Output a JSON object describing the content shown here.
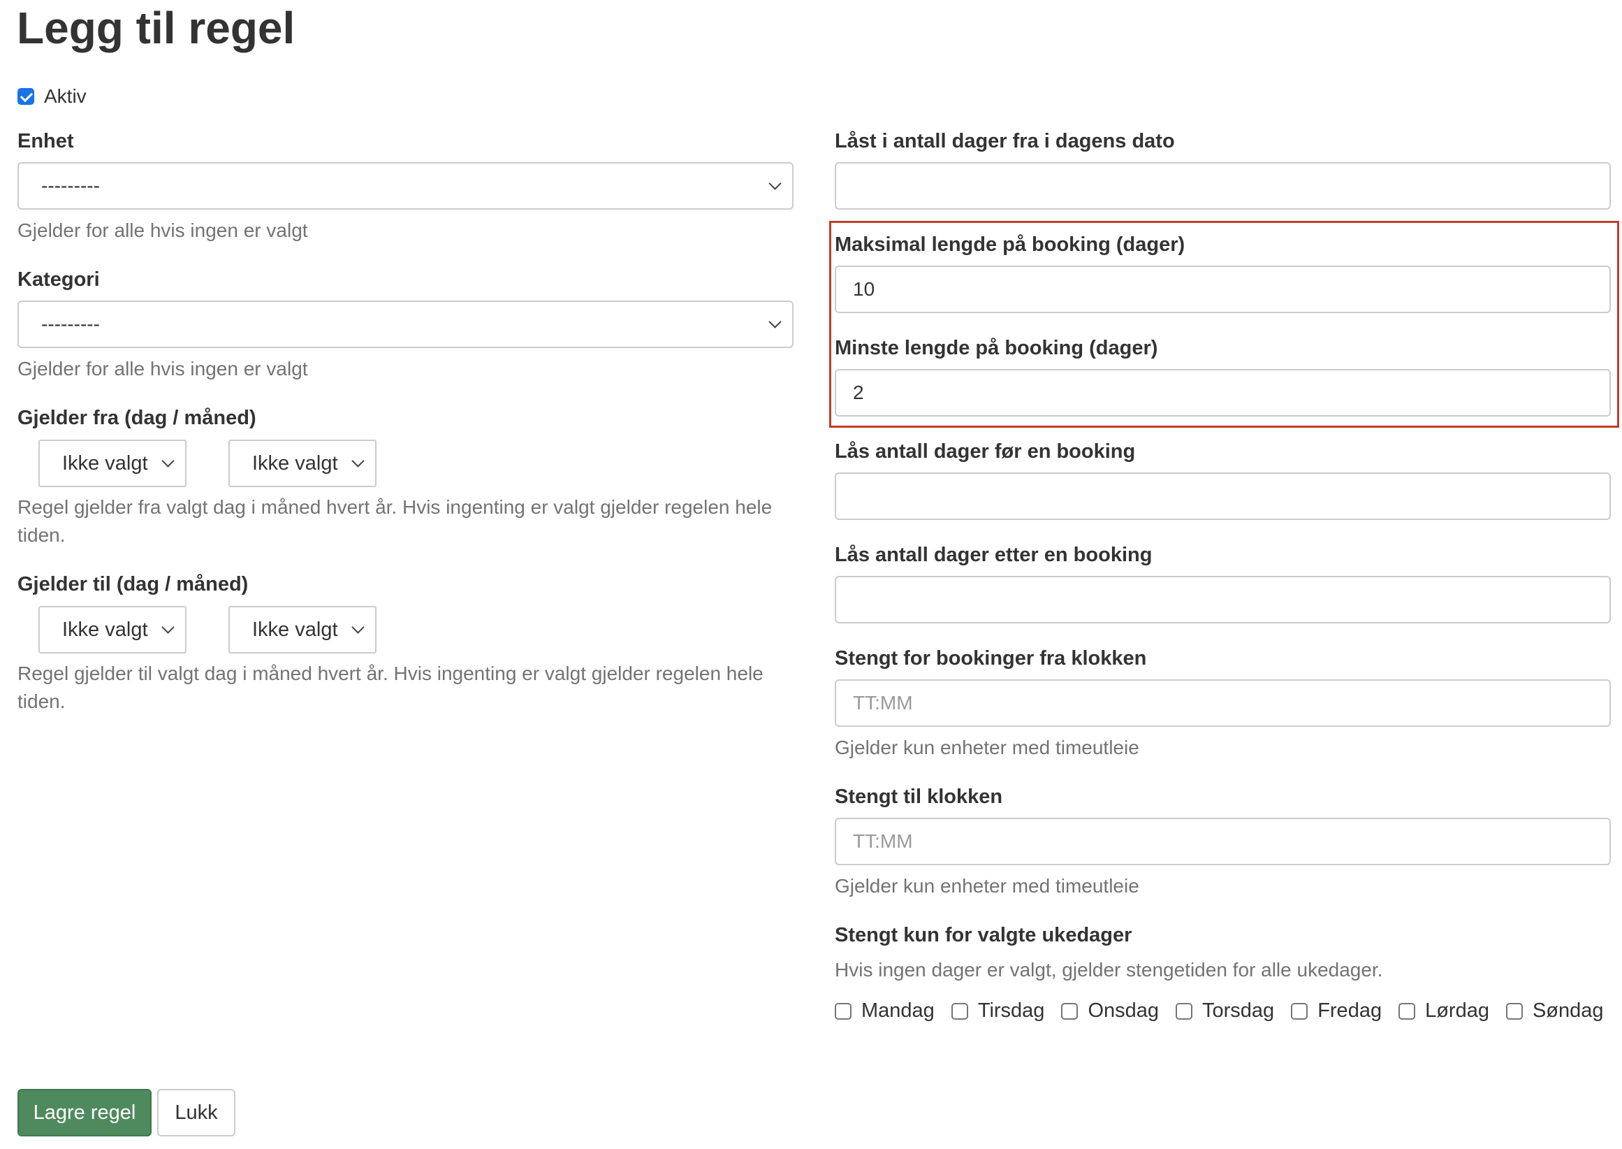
{
  "page": {
    "title": "Legg til regel"
  },
  "aktiv": {
    "label": "Aktiv",
    "checked": true
  },
  "left": {
    "enhet": {
      "label": "Enhet",
      "value": "---------",
      "help": "Gjelder for alle hvis ingen er valgt"
    },
    "kategori": {
      "label": "Kategori",
      "value": "---------",
      "help": "Gjelder for alle hvis ingen er valgt"
    },
    "fra": {
      "label": "Gjelder fra (dag / måned)",
      "day_value": "Ikke valgt",
      "month_value": "Ikke valgt",
      "help_line1": "Regel gjelder fra valgt dag i måned hvert år. Hvis ingenting er valgt gjelder regelen hele",
      "help_line2": "tiden."
    },
    "til": {
      "label": "Gjelder til (dag / måned)",
      "day_value": "Ikke valgt",
      "month_value": "Ikke valgt",
      "help_line1": "Regel gjelder til valgt dag i måned hvert år. Hvis ingenting er valgt gjelder regelen hele",
      "help_line2": "tiden."
    }
  },
  "right": {
    "laast": {
      "label": "Låst i antall dager fra i dagens dato",
      "value": ""
    },
    "maks": {
      "label": "Maksimal lengde på booking (dager)",
      "value": "10"
    },
    "minste": {
      "label": "Minste lengde på booking (dager)",
      "value": "2"
    },
    "laas_for": {
      "label": "Lås antall dager før en booking",
      "value": ""
    },
    "laas_etter": {
      "label": "Lås antall dager etter en booking",
      "value": ""
    },
    "stengt_fra": {
      "label": "Stengt for bookinger fra klokken",
      "placeholder": "TT:MM",
      "help": "Gjelder kun enheter med timeutleie"
    },
    "stengt_til": {
      "label": "Stengt til klokken",
      "placeholder": "TT:MM",
      "help": "Gjelder kun enheter med timeutleie"
    },
    "ukedager": {
      "label": "Stengt kun for valgte ukedager",
      "help": "Hvis ingen dager er valgt, gjelder stengetiden for alle ukedager.",
      "days": [
        "Mandag",
        "Tirsdag",
        "Onsdag",
        "Torsdag",
        "Fredag",
        "Lørdag",
        "Søndag"
      ]
    }
  },
  "buttons": {
    "save": "Lagre regel",
    "close": "Lukk"
  },
  "colors": {
    "save_button": "#4e8a5d",
    "highlight_border": "#c43d2b",
    "checkbox_checked": "#1a73e8"
  }
}
